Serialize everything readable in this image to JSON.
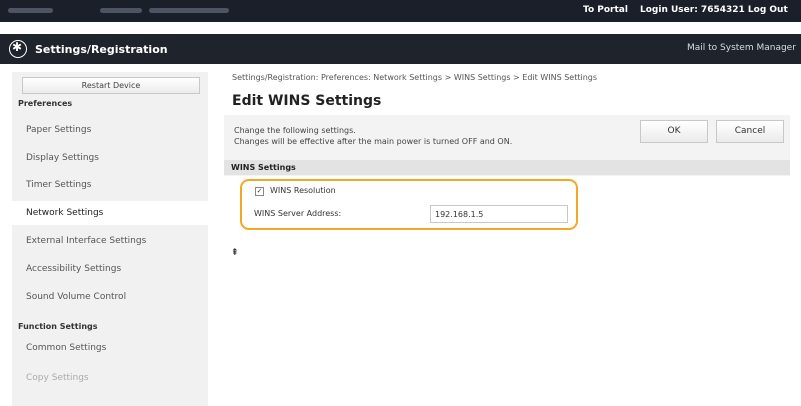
{
  "topbar": {
    "portal_link": "To Portal",
    "login_text": "Login User:  7654321  Log Out"
  },
  "titlebar": {
    "app_icon": "settings-gear-icon",
    "title": "Settings/Registration",
    "mail_link": "Mail to System Manager"
  },
  "sidebar": {
    "restart_label": "Restart Device",
    "sections": [
      "Preferences",
      "Function Settings"
    ],
    "preferences_items": [
      {
        "label": "Paper Settings"
      },
      {
        "label": "Display Settings"
      },
      {
        "label": "Timer Settings"
      },
      {
        "label": "Network Settings"
      },
      {
        "label": "External Interface Settings"
      },
      {
        "label": "Accessibility Settings"
      },
      {
        "label": "Sound Volume Control"
      }
    ],
    "function_items": [
      {
        "label": "Common Settings"
      },
      {
        "label": "Copy Settings"
      }
    ],
    "active_item": "Network Settings"
  },
  "main": {
    "breadcrumb": "Settings/Registration: Preferences: Network Settings > WINS Settings > Edit WINS Settings",
    "title": "Edit WINS Settings",
    "desc_line1": "Change the following settings.",
    "desc_line2": "Changes will be effective after the main power is turned OFF and ON.",
    "ok_label": "OK",
    "cancel_label": "Cancel",
    "section_title": "WINS Settings",
    "wins_resolution_label": "WINS Resolution",
    "wins_resolution_checked": true,
    "server_address_label": "WINS Server Address:",
    "server_address_value": "192.168.1.5",
    "top_icon": "scroll-to-top-icon",
    "highlight_color": "#f5a623"
  }
}
